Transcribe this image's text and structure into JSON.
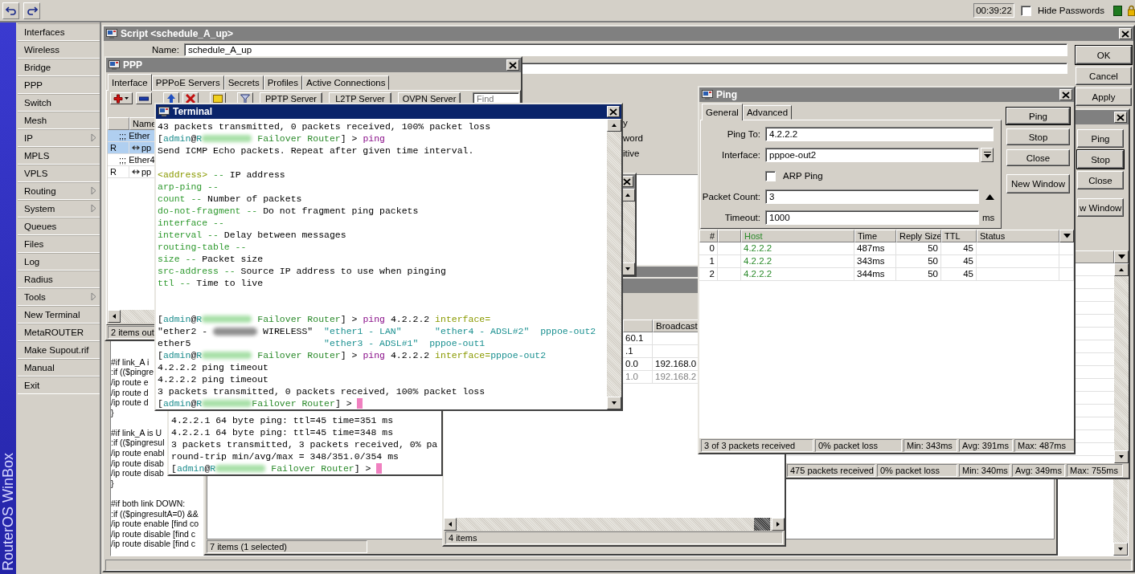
{
  "toolbar": {
    "clock": "00:39:22",
    "hide_passwords": {
      "label": "Hide Passwords",
      "checked": false
    }
  },
  "brand": "RouterOS WinBox",
  "menu": [
    {
      "label": "Interfaces",
      "submenu": false
    },
    {
      "label": "Wireless",
      "submenu": false
    },
    {
      "label": "Bridge",
      "submenu": false
    },
    {
      "label": "PPP",
      "submenu": false
    },
    {
      "label": "Switch",
      "submenu": false
    },
    {
      "label": "Mesh",
      "submenu": false
    },
    {
      "label": "IP",
      "submenu": true
    },
    {
      "label": "MPLS",
      "submenu": false
    },
    {
      "label": "VPLS",
      "submenu": false
    },
    {
      "label": "Routing",
      "submenu": true
    },
    {
      "label": "System",
      "submenu": true
    },
    {
      "label": "Queues",
      "submenu": false
    },
    {
      "label": "Files",
      "submenu": false
    },
    {
      "label": "Log",
      "submenu": false
    },
    {
      "label": "Radius",
      "submenu": false
    },
    {
      "label": "Tools",
      "submenu": true
    },
    {
      "label": "New Terminal",
      "submenu": false
    },
    {
      "label": "MetaROUTER",
      "submenu": false
    },
    {
      "label": "Make Supout.rif",
      "submenu": false
    },
    {
      "label": "Manual",
      "submenu": false
    },
    {
      "label": "Exit",
      "submenu": false
    }
  ],
  "script_window": {
    "title": "Script <schedule_A_up>",
    "active": false,
    "name_label": "Name:",
    "name_value": "schedule_A_up",
    "option_fragments": [
      "y",
      "word",
      "itive"
    ],
    "source_blocks": [
      [
        "#if link_A i",
        ":if (($pingre",
        "/ip route e",
        "/ip route d",
        "/ip route d",
        "}"
      ],
      [
        "#if link_A is U",
        ":if (($pingresul",
        "/ip route enabl",
        "/ip route disab",
        "/ip route disab",
        "}"
      ],
      [
        "#if both link DOWN:",
        ":if (($pingresultA=0) &&",
        "/ip route enable [find co",
        "/ip route disable [find c",
        "/ip route disable [find c"
      ]
    ],
    "buttons": [
      {
        "label": "OK",
        "default": true
      },
      {
        "label": "Cancel",
        "default": false
      },
      {
        "label": "Apply",
        "default": false
      }
    ]
  },
  "list_window": {
    "status": "7 items (1 selected)"
  },
  "ping_window_back": {
    "buttons": [
      {
        "label": "Ping",
        "default": false
      },
      {
        "label": "Stop",
        "default": true
      },
      {
        "label": "Close",
        "default": false
      },
      {
        "label": "w Window",
        "default": false
      }
    ],
    "status": [
      "475 packets received",
      "0% packet loss",
      "Min: 340ms",
      "Avg: 349ms",
      "Max: 755ms"
    ]
  },
  "address_window": {
    "columns": [
      "Broadcast"
    ],
    "rows": [
      {
        "column_1": "60.1",
        "disabled": false
      },
      {
        "column_1": ".1",
        "disabled": false
      },
      {
        "column_1": "0.0",
        "broadcast": "192.168.0",
        "disabled": false
      },
      {
        "column_1": "1.0",
        "broadcast": "192.168.2",
        "disabled": true
      }
    ],
    "status": "4 items"
  },
  "ppp_window": {
    "title": "PPP",
    "active": false,
    "tabs": [
      {
        "label": "Interface",
        "selected": true
      },
      {
        "label": "PPPoE Servers",
        "selected": false
      },
      {
        "label": "Secrets",
        "selected": false
      },
      {
        "label": "Profiles",
        "selected": false
      },
      {
        "label": "Active Connections",
        "selected": false
      }
    ],
    "server_buttons": [
      "PPTP Server",
      "L2TP Server",
      "OVPN Server"
    ],
    "find": {
      "placeholder": "Find"
    },
    "columns": [
      "Name"
    ],
    "rows": [
      {
        "kind": "comment",
        "name": ";;; Ether",
        "selected": true
      },
      {
        "kind": "interface",
        "flag": "R",
        "name": "pp",
        "selected": true
      },
      {
        "kind": "comment",
        "name": ";;; Ether4",
        "selected": false
      },
      {
        "kind": "interface",
        "flag": "R",
        "name": "pp",
        "selected": false
      }
    ],
    "status": "2 items out"
  },
  "terminal_back": {
    "lines": [
      {
        "segments": [
          {
            "kind": "text",
            "text": "4.2.2.1 64 byte ping: ttl=45 time=351 ms"
          }
        ]
      },
      {
        "segments": [
          {
            "kind": "text",
            "text": "4.2.2.1 64 byte ping: ttl=45 time=348 ms"
          }
        ]
      },
      {
        "segments": [
          {
            "kind": "text",
            "text": "3 packets transmitted, 3 packets received, 0% pa"
          }
        ]
      },
      {
        "segments": [
          {
            "kind": "text",
            "text": "round-trip min/avg/max = 348/351.0/354 ms"
          }
        ]
      },
      {
        "segments": [
          {
            "kind": "text",
            "text": "["
          },
          {
            "kind": "user",
            "text": "admin"
          },
          {
            "kind": "text",
            "text": "@"
          },
          {
            "kind": "user",
            "text": "R"
          },
          {
            "kind": "blur"
          },
          {
            "kind": "host",
            "text": " Failover Router"
          },
          {
            "kind": "text",
            "text": "] > "
          },
          {
            "kind": "cursor"
          }
        ]
      }
    ]
  },
  "terminal": {
    "title": "Terminal",
    "active": true,
    "lines": [
      {
        "segments": [
          {
            "kind": "text",
            "text": "43 packets transmitted, 0 packets received, 100% packet loss"
          }
        ]
      },
      {
        "segments": [
          {
            "kind": "text",
            "text": "["
          },
          {
            "kind": "user",
            "text": "admin"
          },
          {
            "kind": "text",
            "text": "@"
          },
          {
            "kind": "user",
            "text": "R"
          },
          {
            "kind": "blur"
          },
          {
            "kind": "host",
            "text": " Failover Router"
          },
          {
            "kind": "text",
            "text": "] > "
          },
          {
            "kind": "cmd",
            "text": "ping"
          }
        ]
      },
      {
        "segments": [
          {
            "kind": "text",
            "text": "Send ICMP Echo packets. Repeat after given time interval."
          }
        ]
      },
      {
        "kind": "blank"
      },
      {
        "segments": [
          {
            "kind": "key",
            "text": "<address>"
          },
          {
            "kind": "param",
            "text": " --"
          },
          {
            "kind": "text",
            "text": " IP address"
          }
        ]
      },
      {
        "segments": [
          {
            "kind": "param",
            "text": "arp-ping --"
          }
        ]
      },
      {
        "segments": [
          {
            "kind": "param",
            "text": "count --"
          },
          {
            "kind": "text",
            "text": " Number of packets"
          }
        ]
      },
      {
        "segments": [
          {
            "kind": "param",
            "text": "do-not-fragment --"
          },
          {
            "kind": "text",
            "text": " Do not fragment ping packets"
          }
        ]
      },
      {
        "segments": [
          {
            "kind": "param",
            "text": "interface --"
          }
        ]
      },
      {
        "segments": [
          {
            "kind": "param",
            "text": "interval --"
          },
          {
            "kind": "text",
            "text": " Delay between messages"
          }
        ]
      },
      {
        "segments": [
          {
            "kind": "param",
            "text": "routing-table --"
          }
        ]
      },
      {
        "segments": [
          {
            "kind": "param",
            "text": "size --"
          },
          {
            "kind": "text",
            "text": " Packet size"
          }
        ]
      },
      {
        "segments": [
          {
            "kind": "param",
            "text": "src-address --"
          },
          {
            "kind": "text",
            "text": " Source IP address to use when pinging"
          }
        ]
      },
      {
        "segments": [
          {
            "kind": "param",
            "text": "ttl --"
          },
          {
            "kind": "text",
            "text": " Time to live"
          }
        ]
      },
      {
        "kind": "blank"
      },
      {
        "kind": "blank"
      },
      {
        "segments": [
          {
            "kind": "text",
            "text": "["
          },
          {
            "kind": "user",
            "text": "admin"
          },
          {
            "kind": "text",
            "text": "@"
          },
          {
            "kind": "user",
            "text": "R"
          },
          {
            "kind": "blur"
          },
          {
            "kind": "host",
            "text": " Failover Router"
          },
          {
            "kind": "text",
            "text": "] > "
          },
          {
            "kind": "cmd",
            "text": "ping"
          },
          {
            "kind": "text",
            "text": " 4.2.2.2 "
          },
          {
            "kind": "key",
            "text": "interface="
          }
        ]
      },
      {
        "segments": [
          {
            "kind": "text",
            "text": "\"ether2 - "
          },
          {
            "kind": "smudge"
          },
          {
            "kind": "text",
            "text": " WIRELESS\"  "
          },
          {
            "kind": "str",
            "text": "\"ether1 - LAN\"      \"ether4 - ADSL#2\"  pppoe-out2"
          }
        ]
      },
      {
        "segments": [
          {
            "kind": "text",
            "text": "ether5                        "
          },
          {
            "kind": "str",
            "text": "\"ether3 - ADSL#1\"  pppoe-out1"
          }
        ]
      },
      {
        "segments": [
          {
            "kind": "text",
            "text": "["
          },
          {
            "kind": "user",
            "text": "admin"
          },
          {
            "kind": "text",
            "text": "@"
          },
          {
            "kind": "user",
            "text": "R"
          },
          {
            "kind": "blur"
          },
          {
            "kind": "host",
            "text": " Failover Router"
          },
          {
            "kind": "text",
            "text": "] > "
          },
          {
            "kind": "cmd",
            "text": "ping"
          },
          {
            "kind": "text",
            "text": " 4.2.2.2 "
          },
          {
            "kind": "key",
            "text": "interface="
          },
          {
            "kind": "str",
            "text": "pppoe-out2"
          }
        ]
      },
      {
        "segments": [
          {
            "kind": "text",
            "text": "4.2.2.2 ping timeout"
          }
        ]
      },
      {
        "segments": [
          {
            "kind": "text",
            "text": "4.2.2.2 ping timeout"
          }
        ]
      },
      {
        "segments": [
          {
            "kind": "text",
            "text": "3 packets transmitted, 0 packets received, 100% packet loss"
          }
        ]
      },
      {
        "segments": [
          {
            "kind": "text",
            "text": "["
          },
          {
            "kind": "user",
            "text": "admin"
          },
          {
            "kind": "text",
            "text": "@"
          },
          {
            "kind": "user",
            "text": "R"
          },
          {
            "kind": "blur"
          },
          {
            "kind": "host",
            "text": "Failover Router"
          },
          {
            "kind": "text",
            "text": "] > "
          },
          {
            "kind": "cursor"
          }
        ]
      }
    ]
  },
  "ping_window": {
    "title": "Ping",
    "active": false,
    "tabs": [
      {
        "label": "General",
        "selected": true
      },
      {
        "label": "Advanced",
        "selected": false
      }
    ],
    "ping_to": {
      "label": "Ping To:",
      "value": "4.2.2.2"
    },
    "interface": {
      "label": "Interface:",
      "value": "pppoe-out2"
    },
    "arp_ping": {
      "label": "ARP Ping",
      "checked": false
    },
    "packet_count": {
      "label": "Packet Count:",
      "value": "3"
    },
    "timeout": {
      "label": "Timeout:",
      "value": "1000",
      "unit": "ms"
    },
    "buttons": [
      {
        "label": "Ping",
        "default": true
      },
      {
        "label": "Stop",
        "default": false
      },
      {
        "label": "Close",
        "default": false
      },
      {
        "label": "New Window",
        "default": false
      }
    ],
    "columns": [
      "#",
      "Host",
      "Time",
      "Reply Size",
      "TTL",
      "Status"
    ],
    "rows": [
      {
        "index": "0",
        "host": "4.2.2.2",
        "time": "487ms",
        "reply_size": "50",
        "ttl": "45"
      },
      {
        "index": "1",
        "host": "4.2.2.2",
        "time": "343ms",
        "reply_size": "50",
        "ttl": "45"
      },
      {
        "index": "2",
        "host": "4.2.2.2",
        "time": "344ms",
        "reply_size": "50",
        "ttl": "45"
      }
    ],
    "status": [
      "3 of 3 packets received",
      "0% packet loss",
      "Min: 343ms",
      "Avg: 391ms",
      "Max: 487ms"
    ]
  }
}
